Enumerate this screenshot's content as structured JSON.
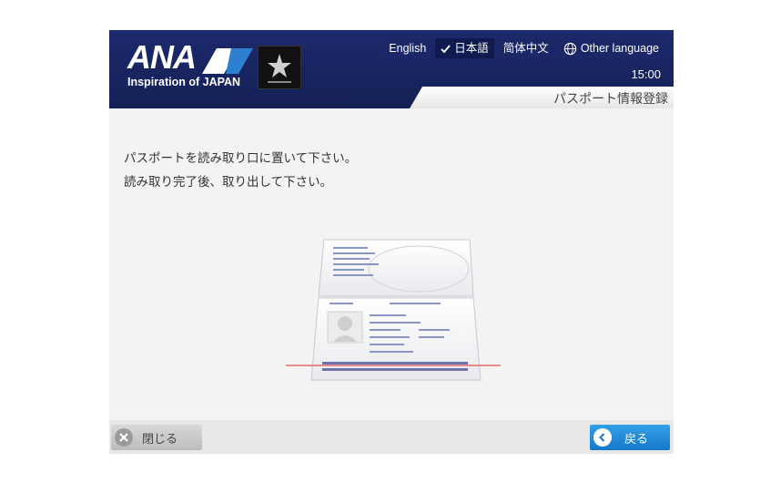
{
  "header": {
    "logo_text": "ANA",
    "tagline": "Inspiration of JAPAN",
    "languages": [
      {
        "label": "English",
        "selected": false
      },
      {
        "label": "日本語",
        "selected": true
      },
      {
        "label": "简体中文",
        "selected": false
      },
      {
        "label": "Other language",
        "selected": false,
        "icon": "globe-icon"
      }
    ],
    "clock": "15:00",
    "page_title": "パスポート情報登録"
  },
  "main": {
    "instruction_lines": [
      "パスポートを読み取り口に置いて下さい。",
      "読み取り完了後、取り出して下さい。"
    ]
  },
  "footer": {
    "close_label": "閉じる",
    "back_label": "戻る"
  },
  "colors": {
    "header_bg": "#1d2a6d",
    "back_button": "#1f87d6",
    "scan_line": "#e46a6a"
  }
}
